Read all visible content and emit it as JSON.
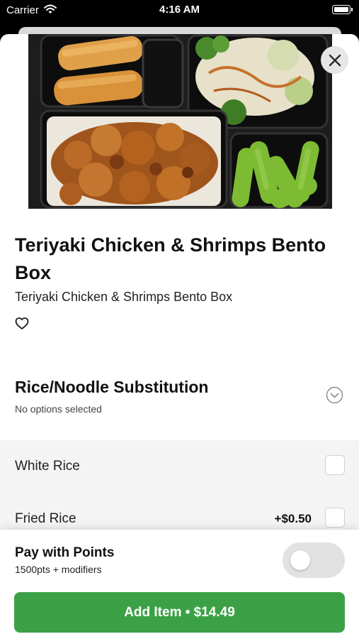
{
  "status_bar": {
    "carrier": "Carrier",
    "time": "4:16 AM",
    "wifi_icon": "wifi-icon",
    "battery_icon": "battery-icon"
  },
  "item": {
    "image_alt": "Teriyaki chicken bento box with egg rolls, vegetables and edamame",
    "title": "Teriyaki Chicken & Shrimps Bento Box",
    "description": "Teriyaki Chicken & Shrimps Bento Box",
    "favorite_icon": "heart-icon",
    "close_icon": "close-icon"
  },
  "modifier_group": {
    "title": "Rice/Noodle Substitution",
    "status": "No options selected",
    "expand_icon": "chevron-down-icon",
    "options": [
      {
        "label": "White Rice",
        "price": ""
      },
      {
        "label": "Fried Rice",
        "price": "+$0.50"
      }
    ]
  },
  "footer": {
    "points_title": "Pay with Points",
    "points_subtitle": "1500pts + modifiers",
    "toggle_on": false,
    "add_button_label": "Add Item • $14.49"
  },
  "colors": {
    "accent": "#3ca146",
    "toggle_off": "#e2e2e2",
    "options_bg": "#f4f4f4"
  }
}
